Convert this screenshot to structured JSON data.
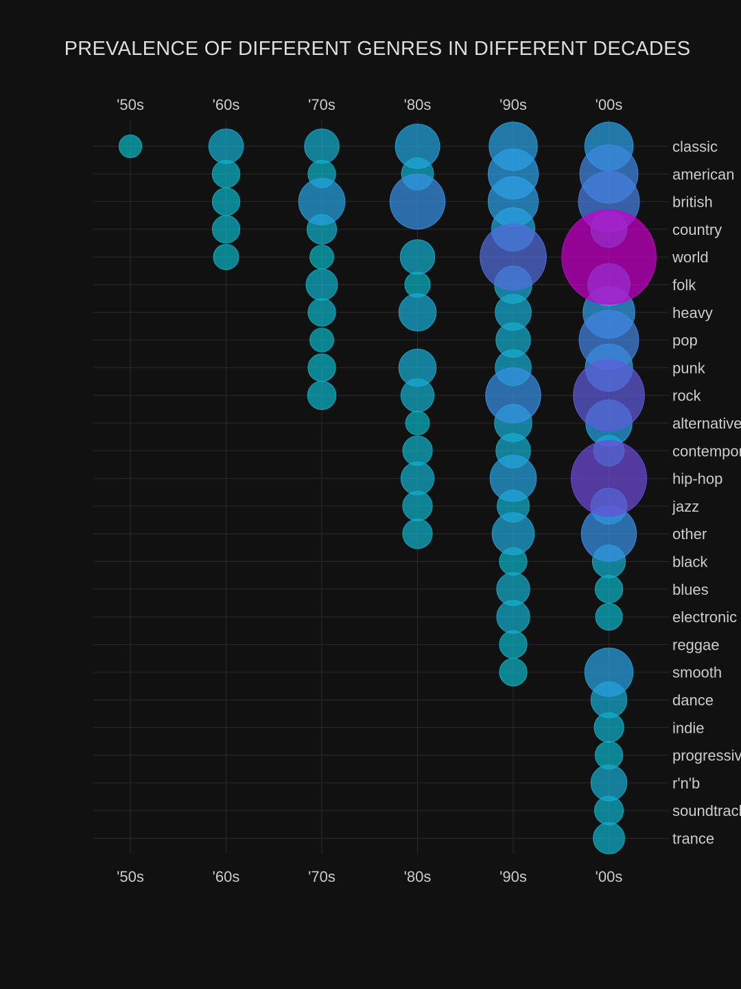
{
  "chart_data": {
    "type": "scatter",
    "title": "PREVALENCE OF DIFFERENT GENRES IN DIFFERENT DECADES",
    "x_categories": [
      "'50s",
      "'60s",
      "'70s",
      "'80s",
      "'90s",
      "'00s"
    ],
    "y_categories": [
      "classic",
      "american",
      "british",
      "country",
      "world",
      "folk",
      "heavy",
      "pop",
      "punk",
      "rock",
      "alternative",
      "contemporary",
      "hip-hop",
      "jazz",
      "other",
      "black",
      "blues",
      "electronic",
      "reggae",
      "smooth",
      "dance",
      "indie",
      "progressive",
      "r'n'b",
      "soundtrack",
      "trance"
    ],
    "size_metric": "relative prevalence",
    "color_scale": [
      "#00b8b8",
      "#2e9ee6",
      "#6a4fd6",
      "#c800c8"
    ],
    "points": [
      {
        "x": "'50s",
        "y": "classic",
        "size": 1
      },
      {
        "x": "'60s",
        "y": "classic",
        "size": 4
      },
      {
        "x": "'60s",
        "y": "american",
        "size": 2
      },
      {
        "x": "'60s",
        "y": "british",
        "size": 2
      },
      {
        "x": "'60s",
        "y": "country",
        "size": 2
      },
      {
        "x": "'60s",
        "y": "world",
        "size": 1.5
      },
      {
        "x": "'70s",
        "y": "classic",
        "size": 4
      },
      {
        "x": "'70s",
        "y": "american",
        "size": 2
      },
      {
        "x": "'70s",
        "y": "british",
        "size": 9
      },
      {
        "x": "'70s",
        "y": "country",
        "size": 2.5
      },
      {
        "x": "'70s",
        "y": "world",
        "size": 1.2
      },
      {
        "x": "'70s",
        "y": "folk",
        "size": 3
      },
      {
        "x": "'70s",
        "y": "heavy",
        "size": 2
      },
      {
        "x": "'70s",
        "y": "pop",
        "size": 1.2
      },
      {
        "x": "'70s",
        "y": "punk",
        "size": 2
      },
      {
        "x": "'70s",
        "y": "rock",
        "size": 2.2
      },
      {
        "x": "'80s",
        "y": "classic",
        "size": 8
      },
      {
        "x": "'80s",
        "y": "american",
        "size": 3.2
      },
      {
        "x": "'80s",
        "y": "british",
        "size": 14
      },
      {
        "x": "'80s",
        "y": "world",
        "size": 4
      },
      {
        "x": "'80s",
        "y": "folk",
        "size": 1.5
      },
      {
        "x": "'80s",
        "y": "heavy",
        "size": 5
      },
      {
        "x": "'80s",
        "y": "punk",
        "size": 5
      },
      {
        "x": "'80s",
        "y": "rock",
        "size": 3.5
      },
      {
        "x": "'80s",
        "y": "alternative",
        "size": 1.2
      },
      {
        "x": "'80s",
        "y": "contemporary",
        "size": 2.5
      },
      {
        "x": "'80s",
        "y": "hip-hop",
        "size": 3.5
      },
      {
        "x": "'80s",
        "y": "jazz",
        "size": 2.5
      },
      {
        "x": "'80s",
        "y": "other",
        "size": 2.5
      },
      {
        "x": "'90s",
        "y": "classic",
        "size": 10
      },
      {
        "x": "'90s",
        "y": "american",
        "size": 11
      },
      {
        "x": "'90s",
        "y": "british",
        "size": 11
      },
      {
        "x": "'90s",
        "y": "country",
        "size": 7.5
      },
      {
        "x": "'90s",
        "y": "world",
        "size": 22
      },
      {
        "x": "'90s",
        "y": "folk",
        "size": 5
      },
      {
        "x": "'90s",
        "y": "heavy",
        "size": 4.5
      },
      {
        "x": "'90s",
        "y": "pop",
        "size": 4
      },
      {
        "x": "'90s",
        "y": "punk",
        "size": 4.5
      },
      {
        "x": "'90s",
        "y": "rock",
        "size": 14
      },
      {
        "x": "'90s",
        "y": "alternative",
        "size": 5
      },
      {
        "x": "'90s",
        "y": "contemporary",
        "size": 4
      },
      {
        "x": "'90s",
        "y": "hip-hop",
        "size": 9
      },
      {
        "x": "'90s",
        "y": "jazz",
        "size": 3.2
      },
      {
        "x": "'90s",
        "y": "other",
        "size": 7
      },
      {
        "x": "'90s",
        "y": "black",
        "size": 2
      },
      {
        "x": "'90s",
        "y": "blues",
        "size": 3.5
      },
      {
        "x": "'90s",
        "y": "electronic",
        "size": 3.5
      },
      {
        "x": "'90s",
        "y": "reggae",
        "size": 2
      },
      {
        "x": "'90s",
        "y": "smooth",
        "size": 2
      },
      {
        "x": "'00s",
        "y": "classic",
        "size": 10
      },
      {
        "x": "'00s",
        "y": "american",
        "size": 16
      },
      {
        "x": "'00s",
        "y": "british",
        "size": 18
      },
      {
        "x": "'00s",
        "y": "country",
        "size": 4.5
      },
      {
        "x": "'00s",
        "y": "world",
        "size": 50
      },
      {
        "x": "'00s",
        "y": "folk",
        "size": 7
      },
      {
        "x": "'00s",
        "y": "heavy",
        "size": 12
      },
      {
        "x": "'00s",
        "y": "pop",
        "size": 17
      },
      {
        "x": "'00s",
        "y": "punk",
        "size": 9.5
      },
      {
        "x": "'00s",
        "y": "rock",
        "size": 26
      },
      {
        "x": "'00s",
        "y": "alternative",
        "size": 9
      },
      {
        "x": "'00s",
        "y": "contemporary",
        "size": 2.8
      },
      {
        "x": "'00s",
        "y": "hip-hop",
        "size": 30
      },
      {
        "x": "'00s",
        "y": "jazz",
        "size": 4.5
      },
      {
        "x": "'00s",
        "y": "other",
        "size": 14
      },
      {
        "x": "'00s",
        "y": "black",
        "size": 3.5
      },
      {
        "x": "'00s",
        "y": "blues",
        "size": 2
      },
      {
        "x": "'00s",
        "y": "electronic",
        "size": 1.8
      },
      {
        "x": "'00s",
        "y": "smooth",
        "size": 10
      },
      {
        "x": "'00s",
        "y": "dance",
        "size": 4.5
      },
      {
        "x": "'00s",
        "y": "indie",
        "size": 2.5
      },
      {
        "x": "'00s",
        "y": "progressive",
        "size": 2
      },
      {
        "x": "'00s",
        "y": "r'n'b",
        "size": 4.5
      },
      {
        "x": "'00s",
        "y": "soundtrack",
        "size": 2.3
      },
      {
        "x": "'00s",
        "y": "trance",
        "size": 3
      }
    ],
    "grid": true,
    "x_axis_labels": "top and bottom",
    "y_axis_labels": "right"
  }
}
